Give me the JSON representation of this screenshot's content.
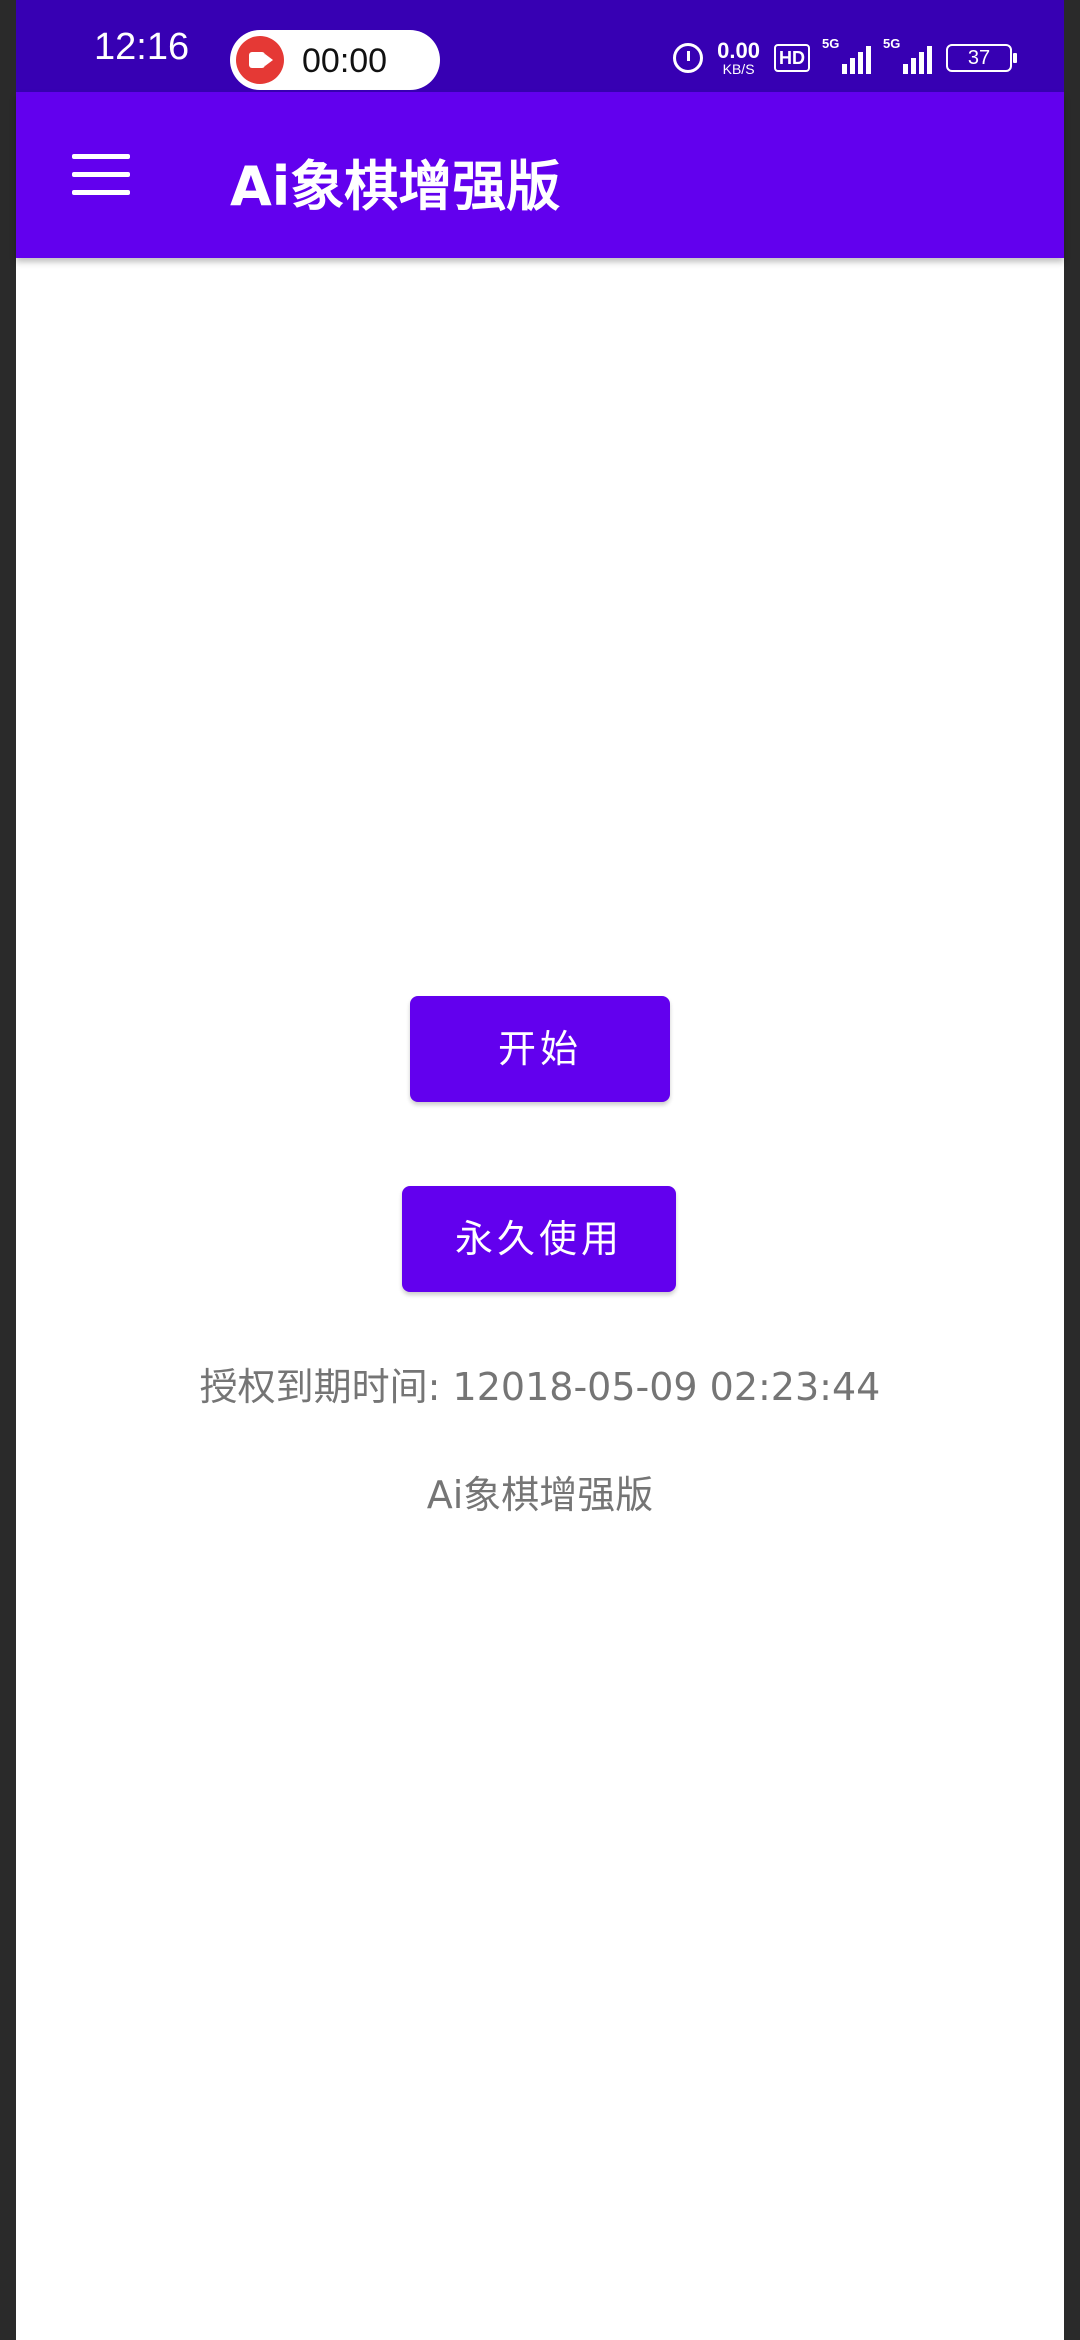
{
  "status_bar": {
    "time": "12:16",
    "recording_time": "00:00",
    "net_speed_value": "0.00",
    "net_speed_unit": "KB/S",
    "hd_label": "HD",
    "signal1_label": "5G",
    "signal2_label": "5G",
    "battery": "37",
    "background": "#3700b3"
  },
  "app_bar": {
    "title": "Ai象棋增强版",
    "background": "#6200ee",
    "menu_icon": "hamburger-menu-icon"
  },
  "main": {
    "start_button": "开始",
    "forever_button": "永久使用",
    "expire_text": "授权到期时间: 12018-05-09 02:23:44",
    "footer_name": "Ai象棋增强版",
    "accent": "#6200ee"
  }
}
